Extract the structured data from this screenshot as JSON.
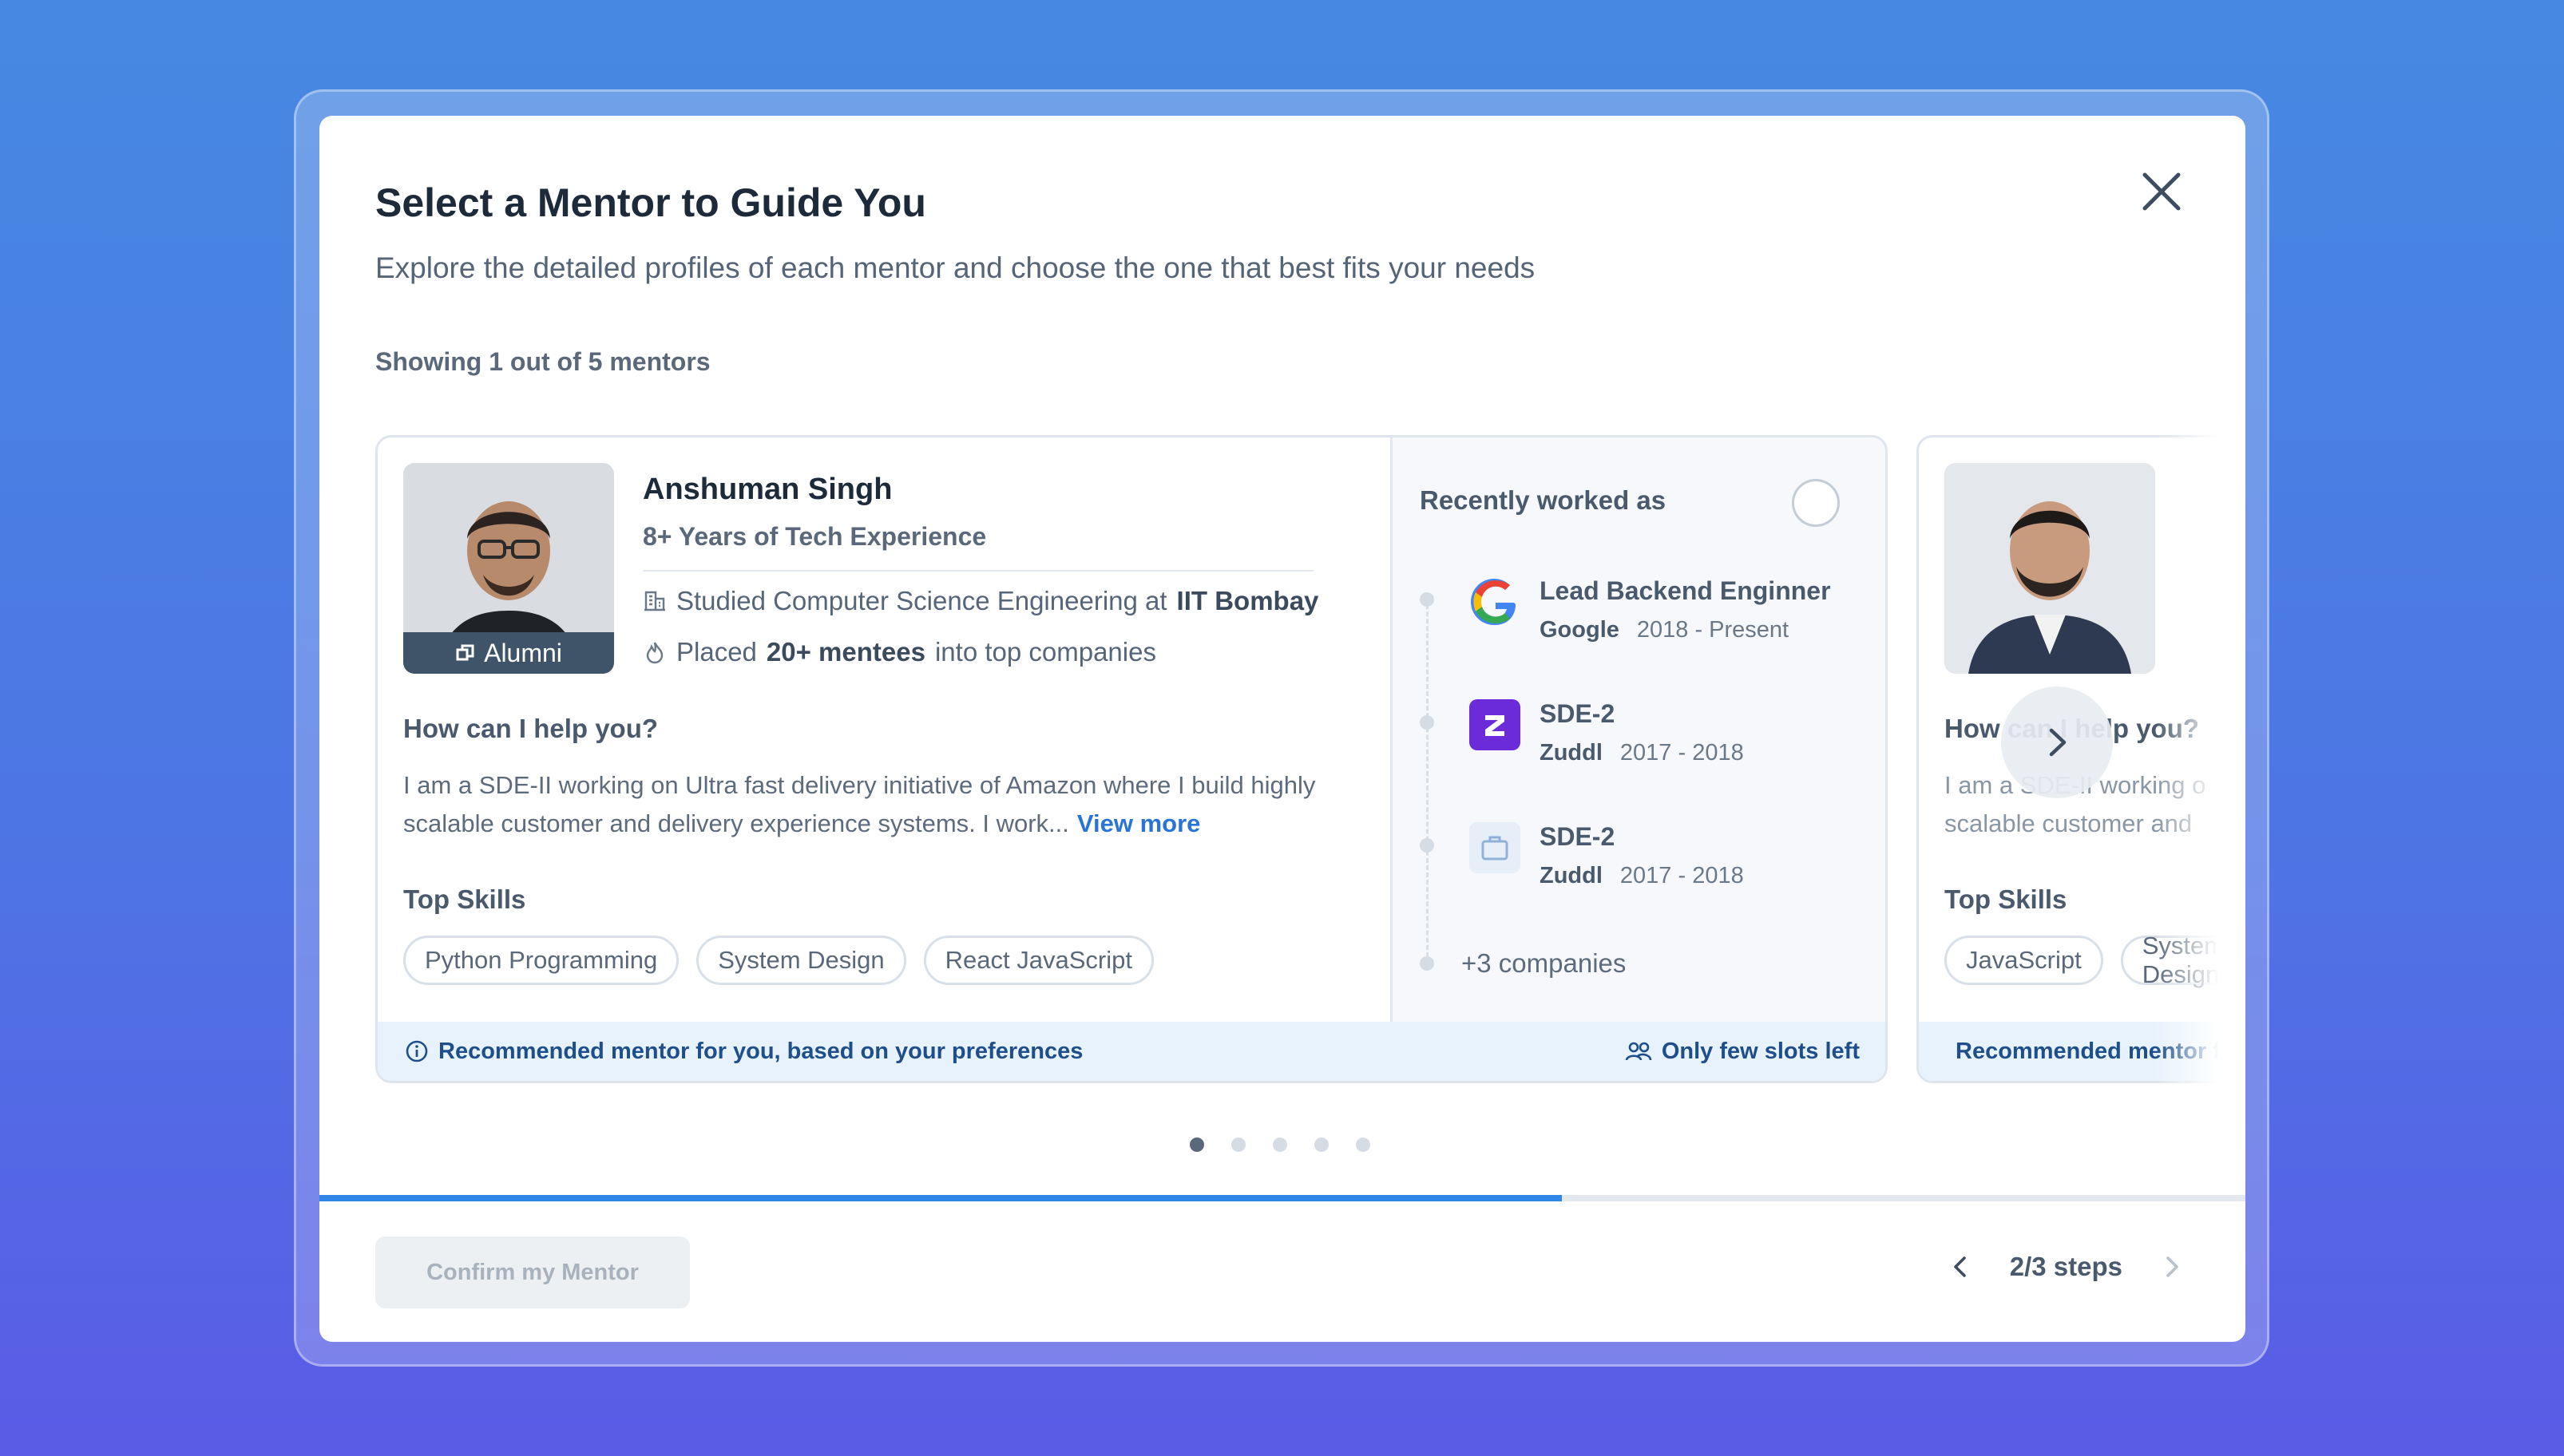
{
  "modal": {
    "title": "Select a Mentor to Guide You",
    "subtitle": "Explore the detailed profiles of each mentor and choose the one that best fits your needs",
    "showing": "Showing 1 out of 5 mentors",
    "close_icon": "close-icon"
  },
  "mentor": {
    "name": "Anshuman Singh",
    "experience": "8+ Years of Tech Experience",
    "alumni_label": "Alumni",
    "studied_prefix": "Studied Computer Science Engineering at",
    "studied_institute": "IIT Bombay",
    "placed_prefix": "Placed",
    "placed_count": "20+ mentees",
    "placed_suffix": "into top companies",
    "help_heading": "How can I help you?",
    "help_text": "I am a SDE-II working on Ultra fast delivery initiative of Amazon where I build highly scalable customer and delivery experience systems. I work...",
    "view_more": "View more",
    "skills_heading": "Top Skills",
    "skills": [
      "Python Programming",
      "System Design",
      "React JavaScript"
    ],
    "recently_worked_heading": "Recently worked as",
    "jobs": [
      {
        "role": "Lead Backend Enginner",
        "company": "Google",
        "period": "2018 - Present",
        "icon": "google-logo-icon"
      },
      {
        "role": "SDE-2",
        "company": "Zuddl",
        "period": "2017 - 2018",
        "icon": "zuddl-logo-icon"
      },
      {
        "role": "SDE-2",
        "company": "Zuddl",
        "period": "2017 - 2018",
        "icon": "briefcase-icon"
      }
    ],
    "more_companies": "+3 companies",
    "footer_recommend": "Recommended mentor for you, based on your preferences",
    "footer_slots": "Only few slots left"
  },
  "next_mentor_preview": {
    "help_heading": "How can I help you?",
    "help_text_line1": "I am a SDE-II working o",
    "help_text_line2": "scalable customer and",
    "skills_heading": "Top Skills",
    "skills": [
      "JavaScript",
      "System Design"
    ],
    "footer_recommend": "Recommended mentor for you"
  },
  "pagination": {
    "total": 5,
    "active": 1
  },
  "progress": {
    "fraction": 0.645
  },
  "footer": {
    "confirm_label": "Confirm my Mentor",
    "steps_label": "2/3 steps"
  },
  "colors": {
    "accent": "#2f86e6",
    "link": "#2a74d8",
    "footer_band": "#e8f2fd",
    "footer_text": "#1f4f8b"
  }
}
